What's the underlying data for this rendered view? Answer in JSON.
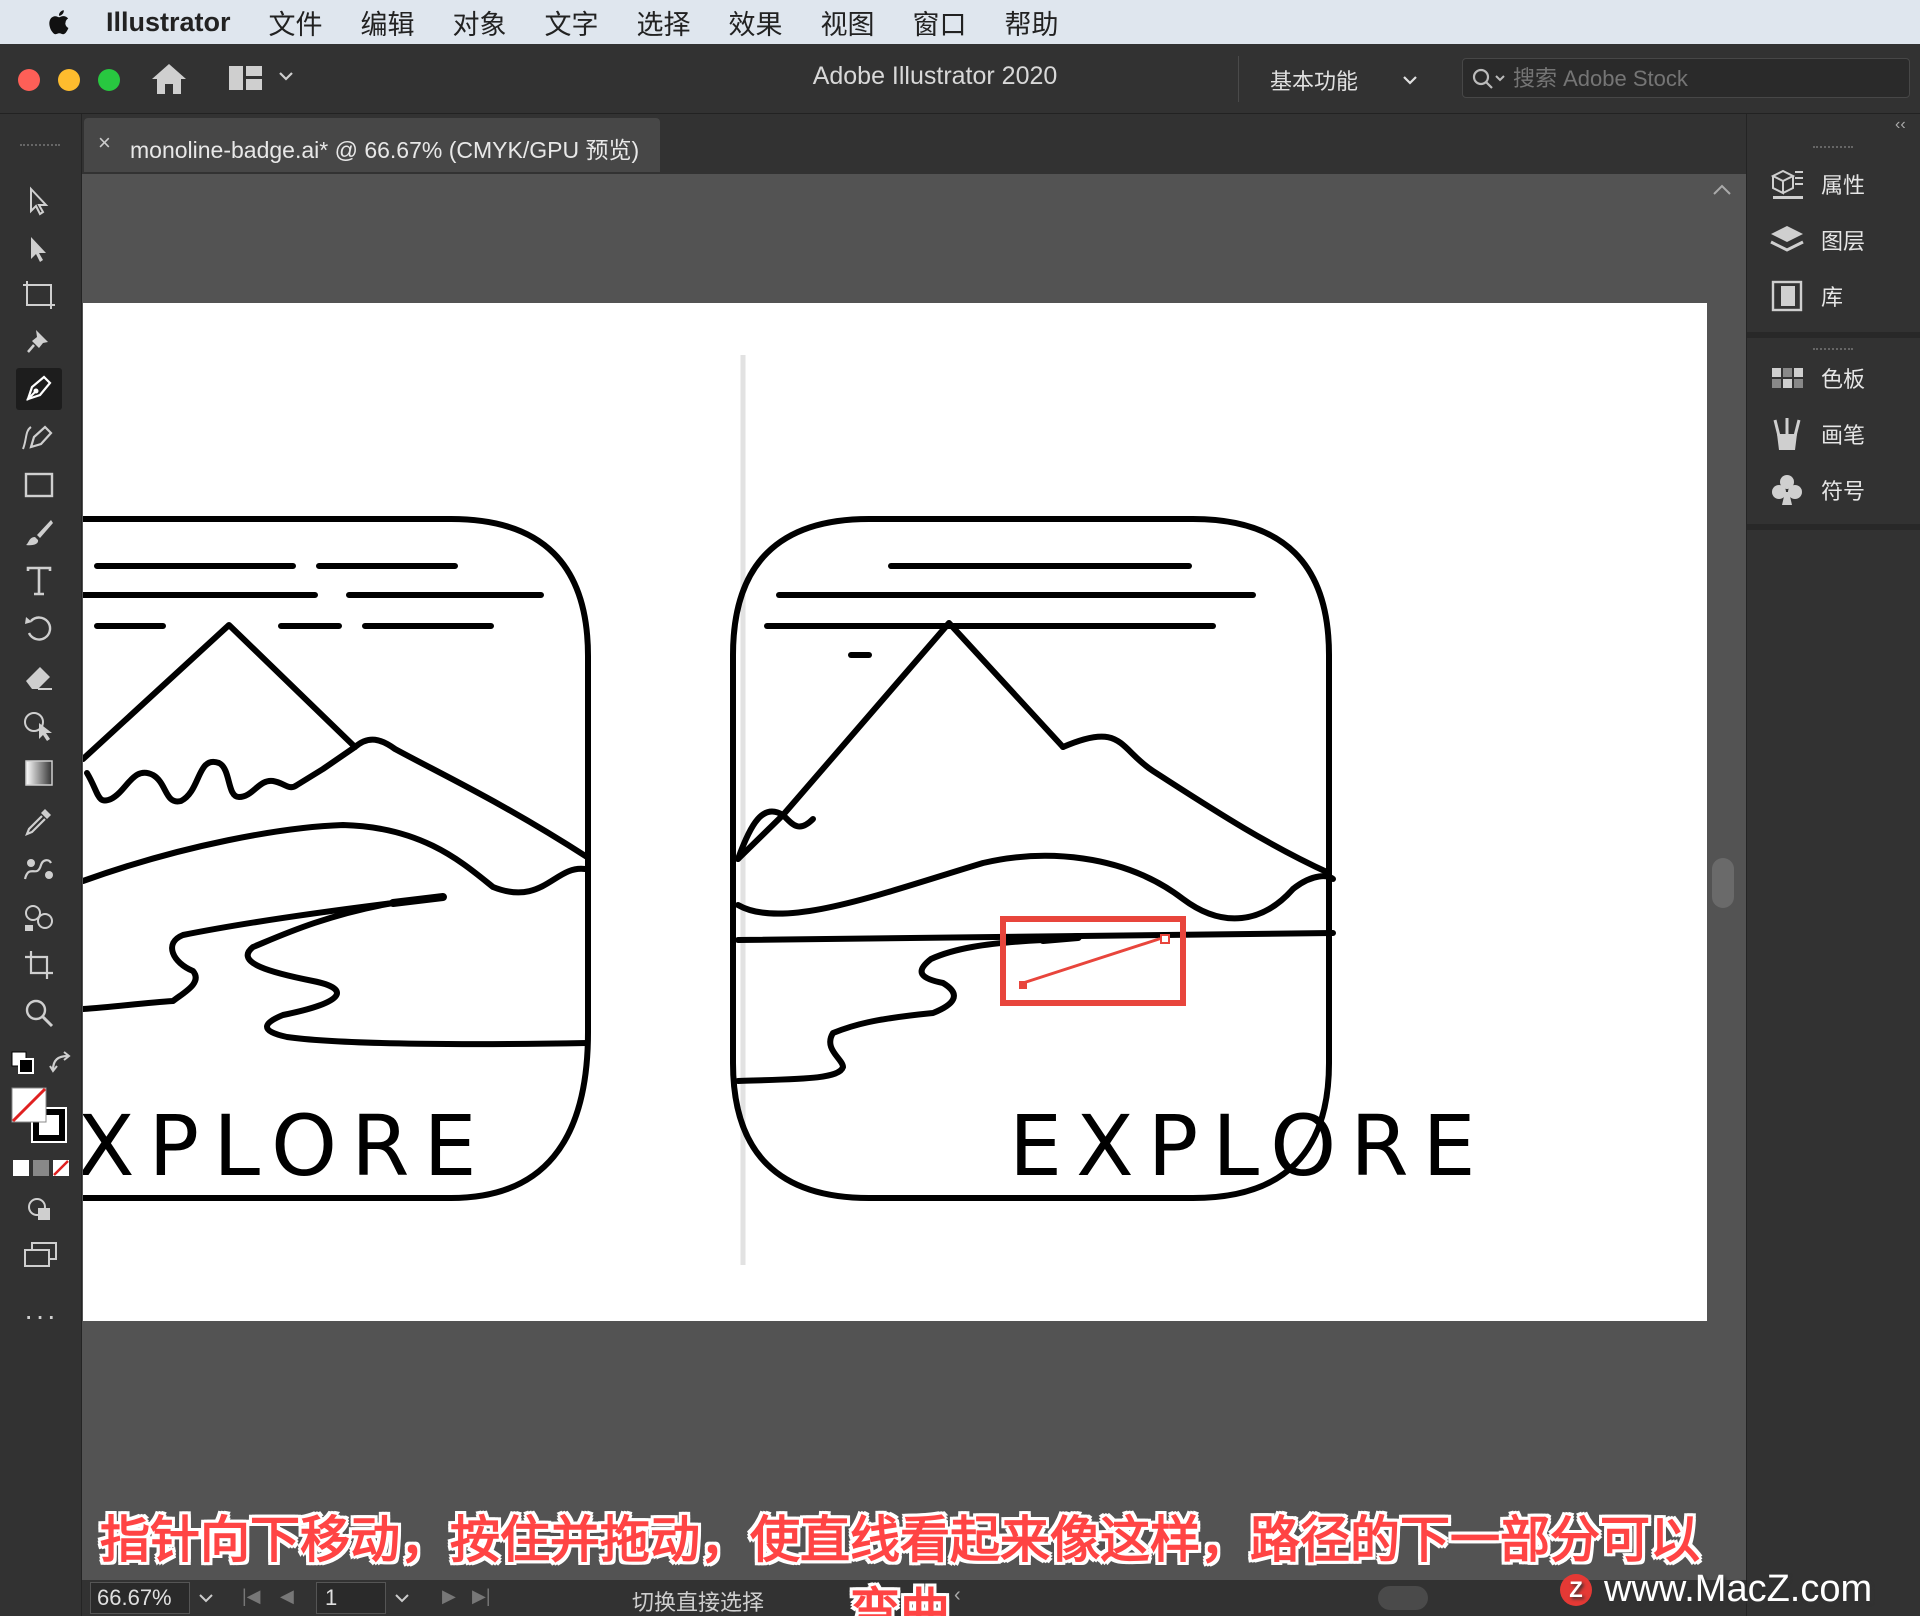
{
  "menubar": {
    "app_name": "Illustrator",
    "items": [
      "文件",
      "编辑",
      "对象",
      "文字",
      "选择",
      "效果",
      "视图",
      "窗口",
      "帮助"
    ]
  },
  "appbar": {
    "title": "Adobe Illustrator 2020",
    "workspace": "基本功能",
    "stock_placeholder": "搜索 Adobe Stock"
  },
  "document_tab": {
    "title": "monoline-badge.ai* @ 66.67% (CMYK/GPU 预览)"
  },
  "artwork": {
    "left_badge_text": "XPLORE",
    "right_badge_text": "EXPLORE",
    "highlight_color": "#e8453c"
  },
  "right_panel": {
    "group1": [
      "属性",
      "图层",
      "库"
    ],
    "group2": [
      "色板",
      "画笔",
      "符号"
    ]
  },
  "status_bar": {
    "zoom": "66.67%",
    "page": "1",
    "status_text": "切换直接选择"
  },
  "caption": "指针向下移动，按住并拖动，使直线看起来像这样，路径的下一部分可以弯曲",
  "watermark": "www.MacZ.com",
  "colors": {
    "chrome_dark": "#323232",
    "canvas_gray": "#535353",
    "caption_red": "#ff4444"
  }
}
